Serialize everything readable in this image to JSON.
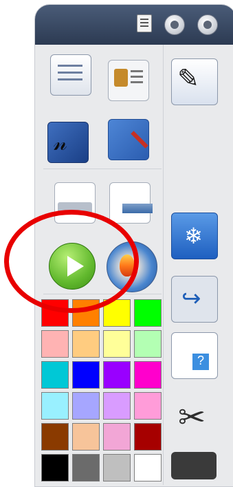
{
  "toolbar": {
    "title_buttons": [
      "document-icon",
      "cloud-icon",
      "user-icon"
    ],
    "left_tools": [
      {
        "name": "attendance-card-icon"
      },
      {
        "name": "id-card-icon"
      },
      {
        "name": "signature-icon"
      },
      {
        "name": "settings-tools-icon"
      },
      {
        "name": "print-document-icon"
      },
      {
        "name": "export-document-icon"
      },
      {
        "name": "play-button-icon"
      },
      {
        "name": "media-disc-icon"
      }
    ],
    "right_tools": [
      {
        "name": "presenter-icon"
      },
      {
        "name": "snowflake-board-icon"
      },
      {
        "name": "clipboard-paste-icon"
      },
      {
        "name": "document-help-icon"
      },
      {
        "name": "scissors-icon"
      },
      {
        "name": "camera-icon"
      }
    ],
    "palette": [
      [
        "#ff0000",
        "#ff8000",
        "#ffff00",
        "#00ff00"
      ],
      [
        "#ffb3b3",
        "#ffcc80",
        "#ffff99",
        "#b3ffb3"
      ],
      [
        "#00c8d6",
        "#0000ff",
        "#9900ff",
        "#ff00cc"
      ],
      [
        "#99f0ff",
        "#a6a6ff",
        "#d99cff",
        "#ff9cd9"
      ],
      [
        "#8a3a00",
        "#f7c49a",
        "#f2a6d6",
        "#a60000"
      ],
      [
        "#000000",
        "#6b6b6b",
        "#bfbfbf",
        "#ffffff"
      ]
    ],
    "highlight_color": "#e80000"
  }
}
